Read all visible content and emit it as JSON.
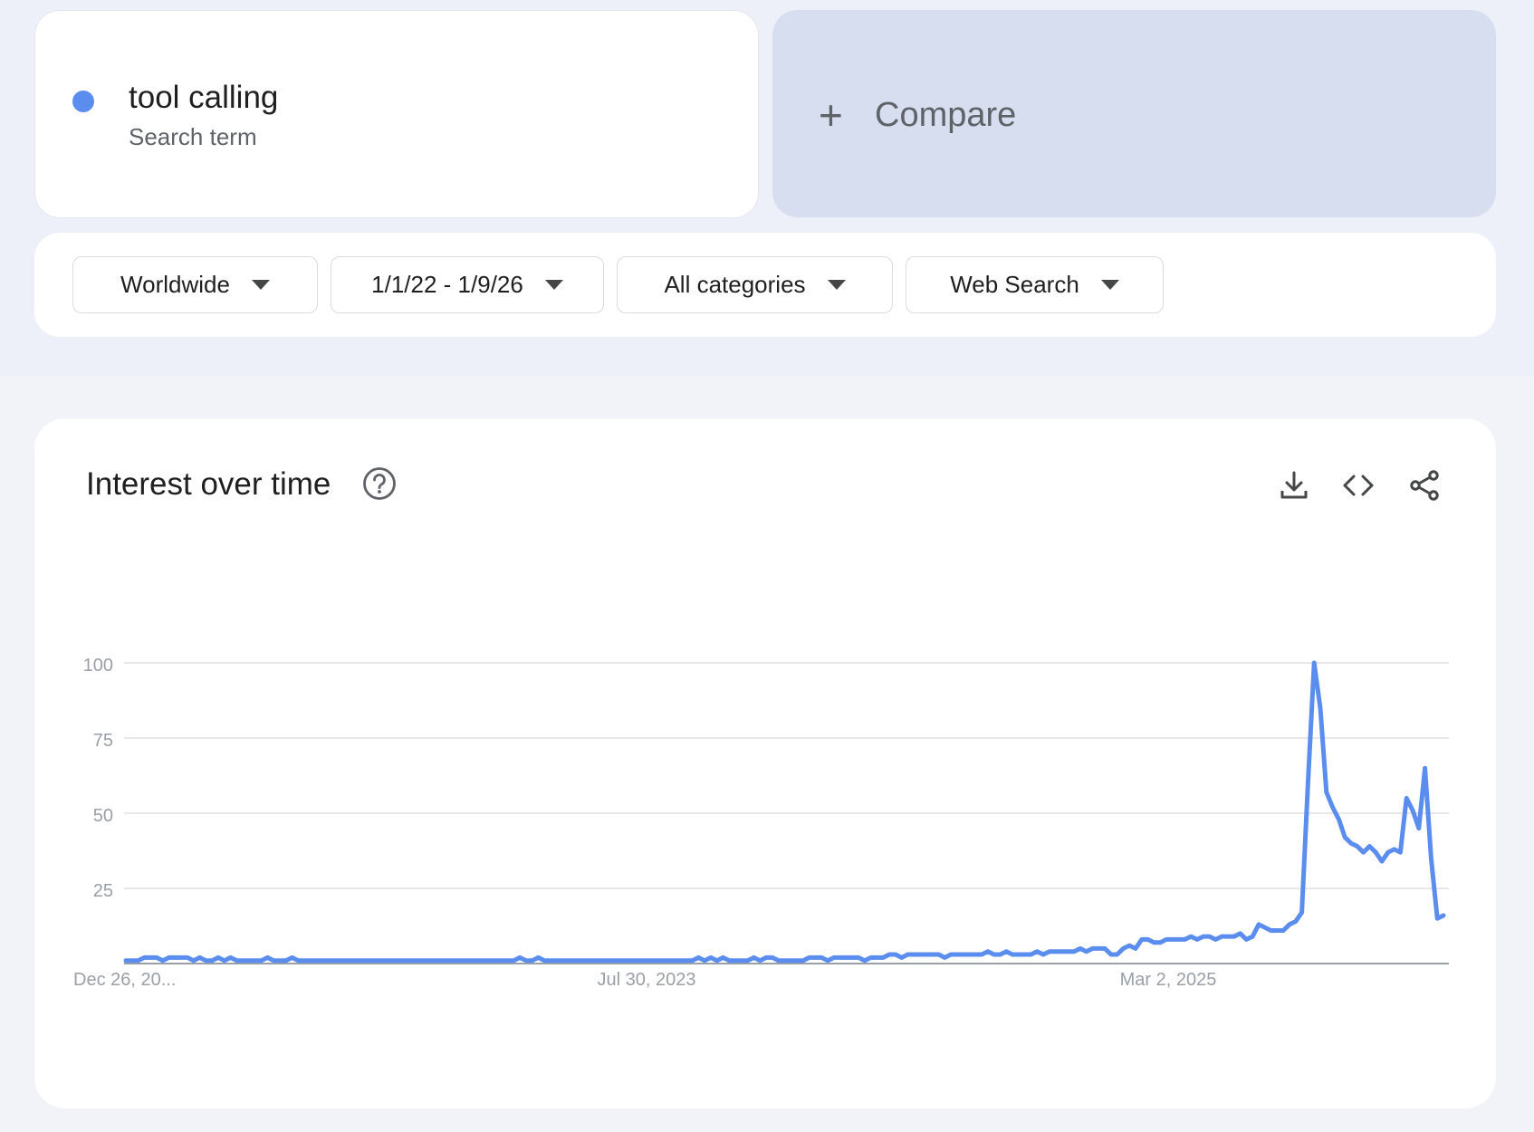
{
  "colors": {
    "series": "#5b8def",
    "compare_bg": "#d7deef",
    "grid": "#e0e0e0",
    "axis": "#9aa0a6",
    "tick_text": "#9aa0a6"
  },
  "search_term": {
    "name": "tool calling",
    "type_label": "Search term"
  },
  "compare": {
    "icon": "plus-icon",
    "label": "Compare"
  },
  "filters": [
    {
      "label": "Worldwide"
    },
    {
      "label": "1/1/22 - 1/9/26"
    },
    {
      "label": "All categories"
    },
    {
      "label": "Web Search"
    }
  ],
  "chart_card": {
    "title": "Interest over time",
    "icons": [
      "help-icon",
      "download-icon",
      "embed-code-icon",
      "share-icon"
    ]
  },
  "chart_data": {
    "type": "line",
    "ylim": [
      0,
      100
    ],
    "yticks": [
      "100",
      "75",
      "50",
      "25"
    ],
    "xtick_labels": [
      "Dec 26, 20...",
      "Jul 30, 2023",
      "Mar 2, 2025"
    ],
    "grid": true,
    "series": [
      {
        "values": [
          1,
          1,
          1,
          2,
          2,
          2,
          1,
          2,
          2,
          2,
          2,
          1,
          2,
          1,
          1,
          2,
          1,
          2,
          1,
          1,
          1,
          1,
          1,
          2,
          1,
          1,
          1,
          2,
          1,
          1,
          1,
          1,
          1,
          1,
          1,
          1,
          1,
          1,
          1,
          1,
          1,
          1,
          1,
          1,
          1,
          1,
          1,
          1,
          1,
          1,
          1,
          1,
          1,
          1,
          1,
          1,
          1,
          1,
          1,
          1,
          1,
          1,
          1,
          1,
          2,
          1,
          1,
          2,
          1,
          1,
          1,
          1,
          1,
          1,
          1,
          1,
          1,
          1,
          1,
          1,
          1,
          1,
          1,
          1,
          1,
          1,
          1,
          1,
          1,
          1,
          1,
          1,
          1,
          2,
          1,
          2,
          1,
          2,
          1,
          1,
          1,
          1,
          2,
          1,
          2,
          2,
          1,
          1,
          1,
          1,
          1,
          2,
          2,
          2,
          1,
          2,
          2,
          2,
          2,
          2,
          1,
          2,
          2,
          2,
          3,
          3,
          2,
          3,
          3,
          3,
          3,
          3,
          3,
          2,
          3,
          3,
          3,
          3,
          3,
          3,
          4,
          3,
          3,
          4,
          3,
          3,
          3,
          3,
          4,
          3,
          4,
          4,
          4,
          4,
          4,
          5,
          4,
          5,
          5,
          5,
          3,
          3,
          5,
          6,
          5,
          8,
          8,
          7,
          7,
          8,
          8,
          8,
          8,
          9,
          8,
          9,
          9,
          8,
          9,
          9,
          9,
          10,
          8,
          9,
          13,
          12,
          11,
          11,
          11,
          13,
          14,
          17,
          60,
          100,
          85,
          57,
          52,
          48,
          42,
          40,
          39,
          37,
          39,
          37,
          34,
          37,
          38,
          37,
          55,
          51,
          45,
          65,
          35,
          15,
          16
        ]
      }
    ]
  }
}
